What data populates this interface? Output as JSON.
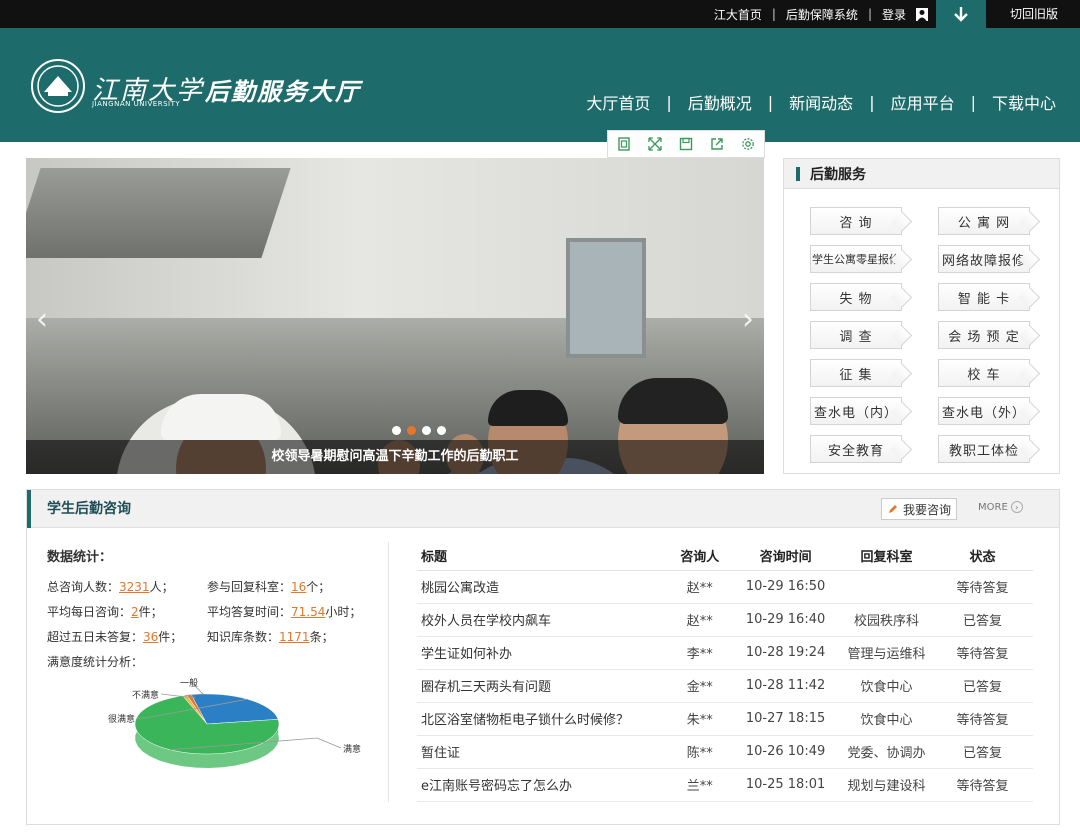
{
  "topbar": {
    "home": "江大首页",
    "logistics_system": "后勤保障系统",
    "login": "登录",
    "old_version": "切回旧版"
  },
  "header": {
    "univ_cn": "江南大学",
    "univ_en": "JIANGNAN UNIVERSITY",
    "hall_title": "后勤服务大厅",
    "nav": [
      "大厅首页",
      "后勤概况",
      "新闻动态",
      "应用平台",
      "下载中心"
    ]
  },
  "banner": {
    "caption": "校领导暑期慰问高温下辛勤工作的后勤职工",
    "slide_count": 4,
    "active_slide": 2
  },
  "services": {
    "title": "后勤服务",
    "items": [
      "咨 询",
      "公 寓 网",
      "学生公寓零星报修",
      "网络故障报修",
      "失 物",
      "智 能 卡",
      "调 查",
      "会 场 预 定",
      "征 集",
      "校 车",
      "查水电（内）",
      "查水电（外）",
      "安全教育",
      "教职工体检"
    ]
  },
  "consult": {
    "title": "学生后勤咨询",
    "ask_label": "我要咨询",
    "more_label": "MORE",
    "stats": {
      "title": "数据统计：",
      "total_label": "总咨询人数：",
      "total": "3231",
      "total_unit": "人；",
      "dept_label": "参与回复科室：",
      "dept": "16",
      "dept_unit": "个；",
      "daily_label": "平均每日咨询：",
      "daily": "2",
      "daily_unit": "件；",
      "reply_label": "平均答复时间：",
      "reply": "71.54",
      "reply_unit": "小时；",
      "overdue_label": "超过五日未答复：",
      "overdue": "36",
      "overdue_unit": "件；",
      "kb_label": "知识库条数：",
      "kb": "1171",
      "kb_unit": "条；",
      "satisfaction_label": "满意度统计分析："
    },
    "pie": {
      "labels": [
        "一般",
        "不满意",
        "很满意",
        "满意"
      ],
      "colors": [
        "#f0b84a",
        "#e8762a",
        "#2b7fc4",
        "#3bb55a"
      ],
      "shares": [
        0.01,
        0.01,
        0.26,
        0.72
      ]
    },
    "table": {
      "headers": [
        "标题",
        "咨询人",
        "咨询时间",
        "回复科室",
        "状态"
      ],
      "rows": [
        [
          "桃园公寓改造",
          "赵**",
          "10-29 16:50",
          "",
          "等待答复"
        ],
        [
          "校外人员在学校内飙车",
          "赵**",
          "10-29 16:40",
          "校园秩序科",
          "已答复"
        ],
        [
          "学生证如何补办",
          "李**",
          "10-28 19:24",
          "管理与运维科",
          "等待答复"
        ],
        [
          "圈存机三天两头有问题",
          "金**",
          "10-28 11:42",
          "饮食中心",
          "已答复"
        ],
        [
          "北区浴室储物柜电子锁什么时候修？",
          "朱**",
          "10-27 18:15",
          "饮食中心",
          "等待答复"
        ],
        [
          "暂住证",
          "陈**",
          "10-26 10:49",
          "党委、协调办",
          "已答复"
        ],
        [
          "e江南账号密码忘了怎么办",
          "兰**",
          "10-25 18:01",
          "规划与建设科",
          "等待答复"
        ]
      ]
    }
  }
}
